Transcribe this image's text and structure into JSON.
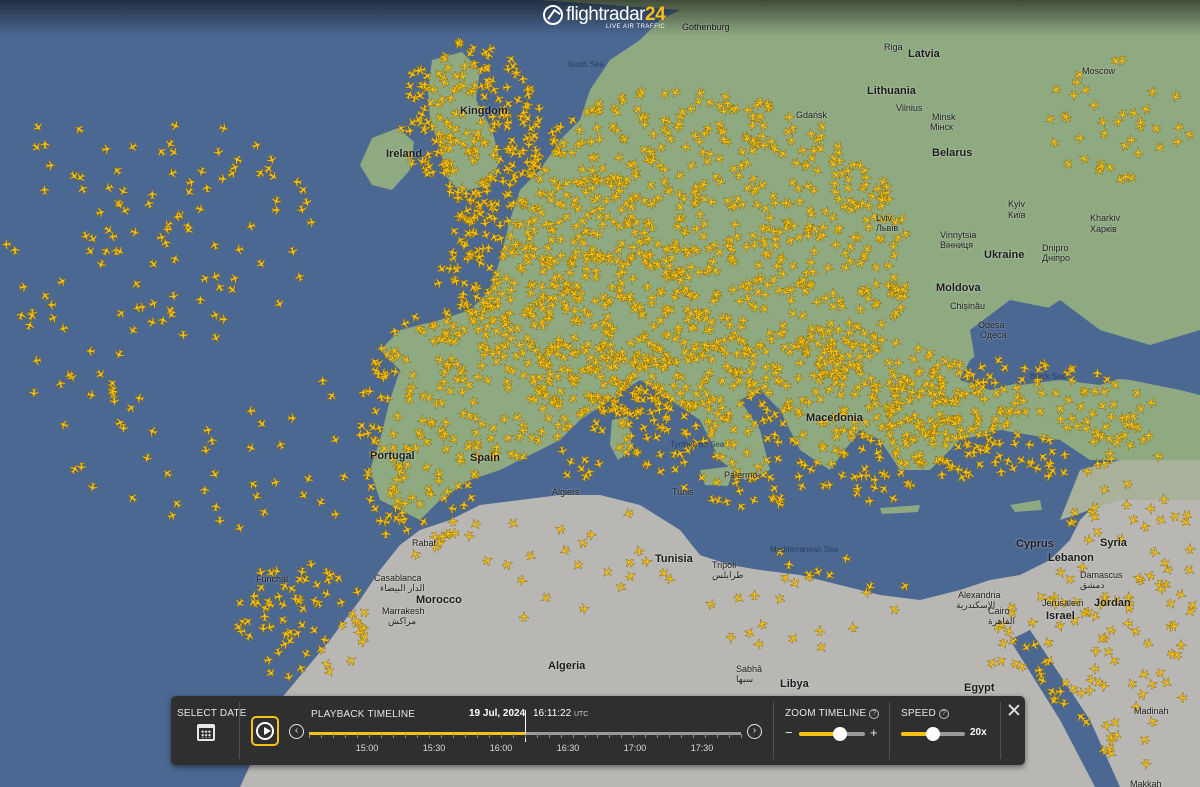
{
  "app": {
    "logo_text": "flightradar",
    "logo_number": "24",
    "logo_subtitle": "LIVE AIR TRAFFIC"
  },
  "map": {
    "colors": {
      "sea": "#4b6893",
      "land_north": "#8fa981",
      "land_south": "#b8b7b3",
      "plane": "#f7c217"
    },
    "labels": [
      {
        "text": "Latvia",
        "kind": "country"
      },
      {
        "text": "Riga",
        "kind": "city"
      },
      {
        "text": "Lithuania",
        "kind": "country"
      },
      {
        "text": "Vilnius",
        "kind": "city"
      },
      {
        "text": "Minsk",
        "kind": "city"
      },
      {
        "text": "Мінск",
        "kind": "city"
      },
      {
        "text": "Belarus",
        "kind": "country"
      },
      {
        "text": "Kyiv",
        "kind": "city"
      },
      {
        "text": "Київ",
        "kind": "city"
      },
      {
        "text": "Kharkiv",
        "kind": "city"
      },
      {
        "text": "Харків",
        "kind": "city"
      },
      {
        "text": "Lviv",
        "kind": "city"
      },
      {
        "text": "Львів",
        "kind": "city"
      },
      {
        "text": "Vinnytsia",
        "kind": "city"
      },
      {
        "text": "Вінниця",
        "kind": "city"
      },
      {
        "text": "Ukraine",
        "kind": "country"
      },
      {
        "text": "Dnipro",
        "kind": "city"
      },
      {
        "text": "Дніпро",
        "kind": "city"
      },
      {
        "text": "Moldova",
        "kind": "country"
      },
      {
        "text": "Chișinău",
        "kind": "city"
      },
      {
        "text": "Odesa",
        "kind": "city"
      },
      {
        "text": "Одеса",
        "kind": "city"
      },
      {
        "text": "Black Sea",
        "kind": "sea"
      },
      {
        "text": "Ireland",
        "kind": "country"
      },
      {
        "text": "Kingdom",
        "kind": "country"
      },
      {
        "text": "North Sea",
        "kind": "sea"
      },
      {
        "text": "Gothenburg",
        "kind": "city"
      },
      {
        "text": "Gdańsk",
        "kind": "city"
      },
      {
        "text": "Moscow",
        "kind": "city"
      },
      {
        "text": "Tyrrhenian Sea",
        "kind": "sea"
      },
      {
        "text": "Mediterranean Sea",
        "kind": "sea"
      },
      {
        "text": "Algiers",
        "kind": "city"
      },
      {
        "text": "Tunis",
        "kind": "city"
      },
      {
        "text": "Tunisia",
        "kind": "country"
      },
      {
        "text": "Tripoli",
        "kind": "city"
      },
      {
        "text": "طرابلس",
        "kind": "city"
      },
      {
        "text": "Algeria",
        "kind": "country"
      },
      {
        "text": "Libya",
        "kind": "country"
      },
      {
        "text": "Sabhā",
        "kind": "city"
      },
      {
        "text": "سبها",
        "kind": "city"
      },
      {
        "text": "Egypt",
        "kind": "country"
      },
      {
        "text": "Alexandria",
        "kind": "city"
      },
      {
        "text": "الإسكندرية",
        "kind": "city"
      },
      {
        "text": "Cairo",
        "kind": "city"
      },
      {
        "text": "القاهرة",
        "kind": "city"
      },
      {
        "text": "Morocco",
        "kind": "country"
      },
      {
        "text": "Casablanca",
        "kind": "city"
      },
      {
        "text": "الدار البيضاء",
        "kind": "city"
      },
      {
        "text": "Marrakesh",
        "kind": "city"
      },
      {
        "text": "مراكش",
        "kind": "city"
      },
      {
        "text": "Rabat",
        "kind": "city"
      },
      {
        "text": "Funchal",
        "kind": "city"
      },
      {
        "text": "Lebanon",
        "kind": "country"
      },
      {
        "text": "Syria",
        "kind": "country"
      },
      {
        "text": "Damascus",
        "kind": "city"
      },
      {
        "text": "دمشق",
        "kind": "city"
      },
      {
        "text": "Jerusalem",
        "kind": "city"
      },
      {
        "text": "Israel",
        "kind": "country"
      },
      {
        "text": "Jordan",
        "kind": "country"
      },
      {
        "text": "Madinah",
        "kind": "city"
      },
      {
        "text": "Makkah",
        "kind": "city"
      },
      {
        "text": "Cyprus",
        "kind": "country"
      },
      {
        "text": "Macedonia",
        "kind": "country"
      },
      {
        "text": "Palermo",
        "kind": "city"
      },
      {
        "text": "Spain",
        "kind": "country"
      },
      {
        "text": "Portugal",
        "kind": "country"
      }
    ]
  },
  "playback": {
    "select_date_label": "SELECT DATE",
    "timeline_label": "PLAYBACK TIMELINE",
    "date": "19 Jul, 2024",
    "time": "16:11:22",
    "time_zone": "UTC",
    "ticks": [
      "15:00",
      "15:30",
      "16:00",
      "16:30",
      "17:00",
      "17:30"
    ],
    "progress": 0.5,
    "prev_icon": "chevron-left-icon",
    "next_icon": "chevron-right-icon",
    "play_icon": "play-icon",
    "zoom_label": "ZOOM TIMELINE",
    "zoom_minus": "−",
    "zoom_plus": "+",
    "zoom_level": 0.62,
    "speed_label": "SPEED",
    "speed_value": "20x",
    "speed_level": 0.5,
    "help_glyph": "?"
  }
}
